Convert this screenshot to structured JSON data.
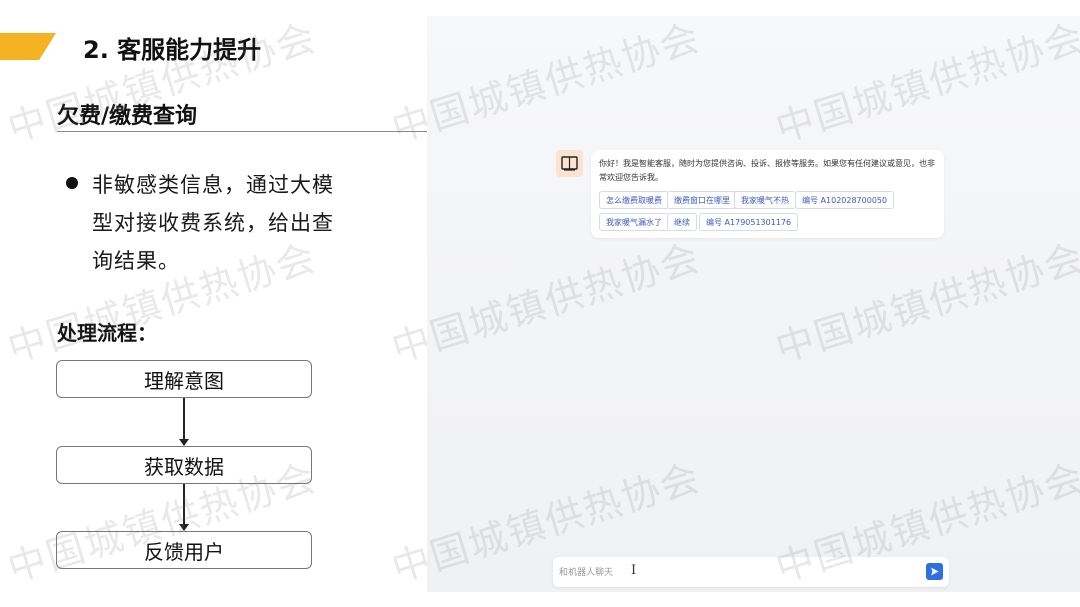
{
  "slide": {
    "title": "2. 客服能力提升",
    "section_title": "欠费/缴费查询",
    "bullet": "非敏感类信息，通过大模型对接收费系统，给出查询结果。",
    "process_title": "处理流程：",
    "steps": [
      "理解意图",
      "获取数据",
      "反馈用户"
    ],
    "accent_color": "#f5b323"
  },
  "chat": {
    "greeting": "你好！我是智能客服，随时为您提供咨询、投诉、报修等服务。如果您有任何建议或意见，也非常欢迎您告诉我。",
    "suggestions": [
      "怎么缴费取暖费",
      "缴费窗口在哪里",
      "我家暖气不热",
      "编号 A102028700050",
      "我家暖气漏水了",
      "继续",
      "编号 A179051301176"
    ],
    "input_placeholder": "和机器人聊天",
    "avatar_icon": "book-icon",
    "send_icon": "send-arrow-icon",
    "send_color": "#2f6fe4"
  },
  "watermark": "中国城镇供热协会"
}
